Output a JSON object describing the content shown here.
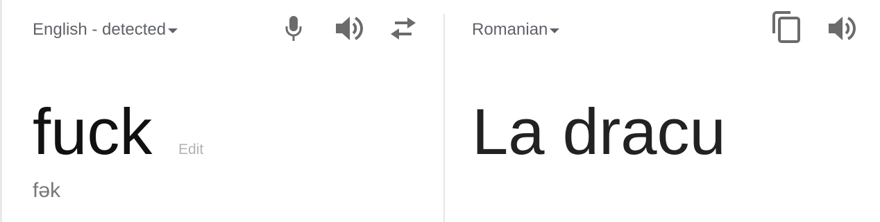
{
  "source": {
    "language_label": "English - detected",
    "text": "fuck",
    "edit_label": "Edit",
    "transliteration": "fək"
  },
  "target": {
    "language_label": "Romanian",
    "text": "La dracu"
  },
  "icons": {
    "microphone": "microphone-icon",
    "source_speaker": "speaker-icon",
    "swap": "swap-languages-icon",
    "copy": "copy-icon",
    "target_speaker": "speaker-icon"
  },
  "colors": {
    "icon": "#6b6b6b",
    "divider": "#e6e6e6",
    "muted_text": "#b3b3b3"
  }
}
